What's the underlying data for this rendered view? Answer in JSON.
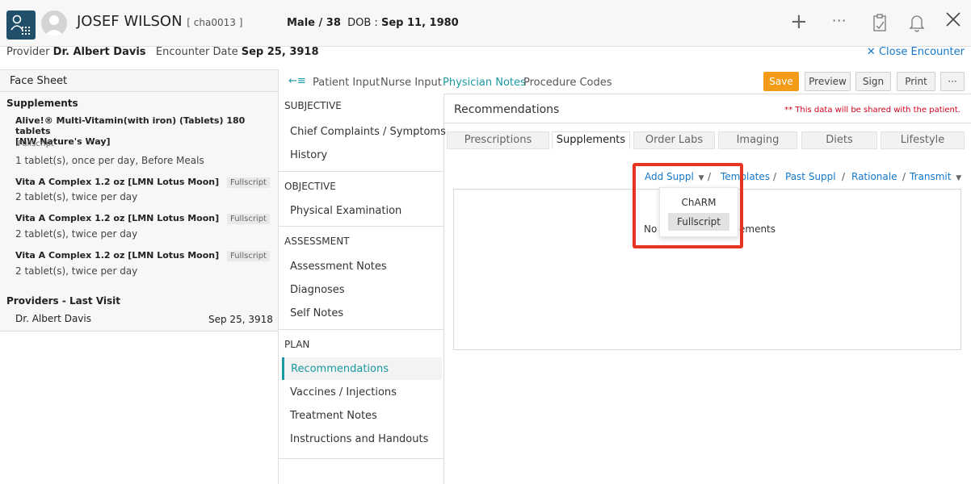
{
  "header": {
    "patient_name": "JOSEF WILSON",
    "patient_id": "[ cha0013 ]",
    "gender_age": "Male / 38",
    "dob_label": "DOB :",
    "dob_value": "Sep 11, 1980",
    "icons": [
      "plus-icon",
      "more-horizontal-icon",
      "clipboard-icon",
      "bell-icon",
      "close-icon"
    ]
  },
  "encounter": {
    "provider_label": "Provider",
    "provider_name": "Dr. Albert Davis",
    "date_label": "Encounter Date",
    "date_value": "Sep 25, 3918",
    "close_label": "Close Encounter"
  },
  "facesheet": {
    "title": "Face Sheet",
    "supplements_heading": "Supplements",
    "supplements": [
      {
        "name": "Alive!® Multi-Vitamin(with iron) (Tablets) 180 tablets",
        "brand": "[NW Nature's Way]",
        "source": "Fullscript",
        "dose": "1 tablet(s), once per day, Before Meals"
      },
      {
        "name": "Vita A Complex 1.2 oz",
        "brand": "[LMN Lotus Moon]",
        "source": "Fullscript",
        "dose": "2 tablet(s), twice per day"
      },
      {
        "name": "Vita A Complex 1.2 oz",
        "brand": "[LMN Lotus Moon]",
        "source": "Fullscript",
        "dose": "2 tablet(s), twice per day"
      },
      {
        "name": "Vita A Complex 1.2 oz",
        "brand": "[LMN Lotus Moon]",
        "source": "Fullscript",
        "dose": "2 tablet(s), twice per day"
      }
    ],
    "providers_heading": "Providers - Last Visit",
    "provider_row": {
      "name": "Dr. Albert Davis",
      "date": "Sep 25, 3918"
    }
  },
  "nav": {
    "tabs": [
      "Patient Input",
      "Nurse Input",
      "Physician Notes",
      "Procedure Codes"
    ],
    "active_tab": "Physician Notes",
    "buttons": {
      "save": "Save",
      "preview": "Preview",
      "sign": "Sign",
      "print": "Print",
      "more": "···"
    }
  },
  "sections": {
    "subjective": {
      "title": "SUBJECTIVE",
      "items": [
        "Chief Complaints / Symptoms",
        "History"
      ]
    },
    "objective": {
      "title": "OBJECTIVE",
      "items": [
        "Physical Examination"
      ]
    },
    "assessment": {
      "title": "ASSESSMENT",
      "items": [
        "Assessment Notes",
        "Diagnoses",
        "Self Notes"
      ]
    },
    "plan": {
      "title": "PLAN",
      "items": [
        "Recommendations",
        "Vaccines / Injections",
        "Treatment Notes",
        "Instructions and Handouts"
      ]
    }
  },
  "recommendations": {
    "title": "Recommendations",
    "shared_note": "** This data will be shared with the patient.",
    "subtabs": [
      "Prescriptions",
      "Supplements",
      "Order Labs",
      "Imaging",
      "Diets",
      "Lifestyle"
    ],
    "active_subtab": "Supplements",
    "toolbar": {
      "add": "Add Suppl",
      "templates": "Templates",
      "past": "Past Suppl",
      "rationale": "Rationale",
      "transmit": "Transmit",
      "separator": "/"
    },
    "empty_left": "No",
    "empty_right": "ements",
    "dropdown_options": [
      "ChARM",
      "Fullscript"
    ],
    "highlighted_option": "Fullscript"
  },
  "colors": {
    "accent": "#1a9aa0",
    "link": "#1577c9",
    "save": "#f49b17",
    "alert": "#d0021b",
    "highlight_box": "#e5341f"
  }
}
